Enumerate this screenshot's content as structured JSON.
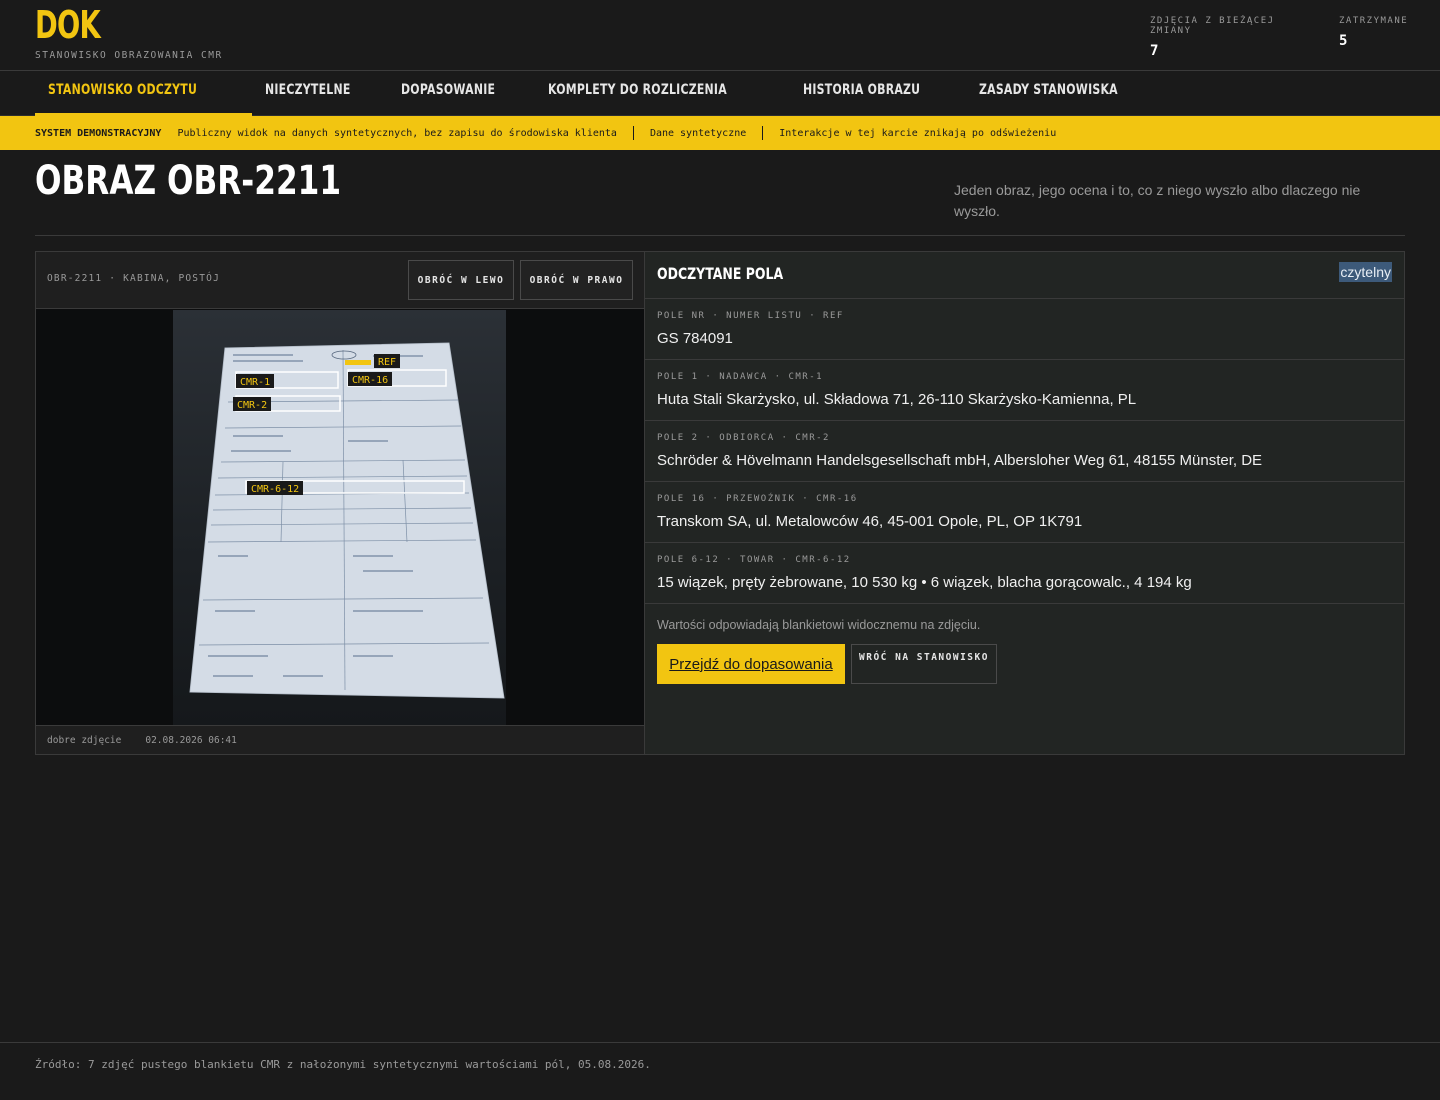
{
  "brand": {
    "name": "DOK",
    "subtitle": "STANOWISKO OBRAZOWANIA CMR"
  },
  "stats": [
    {
      "label": "ZDJĘCIA Z BIEŻĄCEJ ZMIANY",
      "value": "7"
    },
    {
      "label": "ZATRZYMANE",
      "value": "5"
    }
  ],
  "nav": [
    {
      "label": "STANOWISKO ODCZYTU",
      "active": true
    },
    {
      "label": "NIECZYTELNE"
    },
    {
      "label": "DOPASOWANIE"
    },
    {
      "label": "KOMPLETY DO ROZLICZENIA"
    },
    {
      "label": "HISTORIA OBRAZU"
    },
    {
      "label": "ZASADY STANOWISKA"
    }
  ],
  "banner": {
    "strong": "SYSTEM DEMONSTRACYJNY",
    "items": [
      "Publiczny widok na danych syntetycznych, bez zapisu do środowiska klienta",
      "Dane syntetyczne",
      "Interakcje w tej karcie znikają po odświeżeniu"
    ]
  },
  "page": {
    "title": "OBRAZ OBR-2211",
    "description": "Jeden obraz, jego ocena i to, co z niego wyszło albo dlaczego nie wyszło."
  },
  "viewer": {
    "image_id": "OBR-2211 · KABINA, POSTÓJ",
    "rotate_left": "OBRÓĆ W LEWO",
    "rotate_right": "OBRÓĆ W PRAWO",
    "quality": "dobre zdjęcie",
    "timestamp": "02.08.2026 06:41",
    "tags": {
      "ref": "REF",
      "cmr1": "CMR-1",
      "cmr16": "CMR-16",
      "cmr2": "CMR-2",
      "cmr612": "CMR-6-12"
    }
  },
  "fields_panel": {
    "title": "ODCZYTANE POLA",
    "status": "czytelny",
    "fields": [
      {
        "label": "POLE NR · NUMER LISTU · REF",
        "value": "GS 784091"
      },
      {
        "label": "POLE 1 · NADAWCA · CMR-1",
        "value": "Huta Stali Skarżysko, ul. Składowa 71, 26-110 Skarżysko-Kamienna, PL"
      },
      {
        "label": "POLE 2 · ODBIORCA · CMR-2",
        "value": "Schröder & Hövelmann Handelsgesellschaft mbH, Albersloher Weg 61, 48155 Münster, DE"
      },
      {
        "label": "POLE 16 · PRZEWOŹNIK · CMR-16",
        "value": "Transkom SA, ul. Metalowców 46, 45-001 Opole, PL, OP 1K791"
      },
      {
        "label": "POLE 6-12 · TOWAR · CMR-6-12",
        "value": "15 wiązek, pręty żebrowane, 10 530 kg • 6 wiązek, blacha gorącowalc., 4 194 kg"
      }
    ],
    "note": "Wartości odpowiadają blankietowi widocznemu na zdjęciu.",
    "primary_action": "Przejdź do dopasowania",
    "secondary_action": "WRÓĆ NA STANOWISKO"
  },
  "footer": {
    "source": "Źródło: 7 zdjęć pustego blankietu CMR z nałożonymi syntetycznymi wartościami pól, 05.08.2026."
  }
}
